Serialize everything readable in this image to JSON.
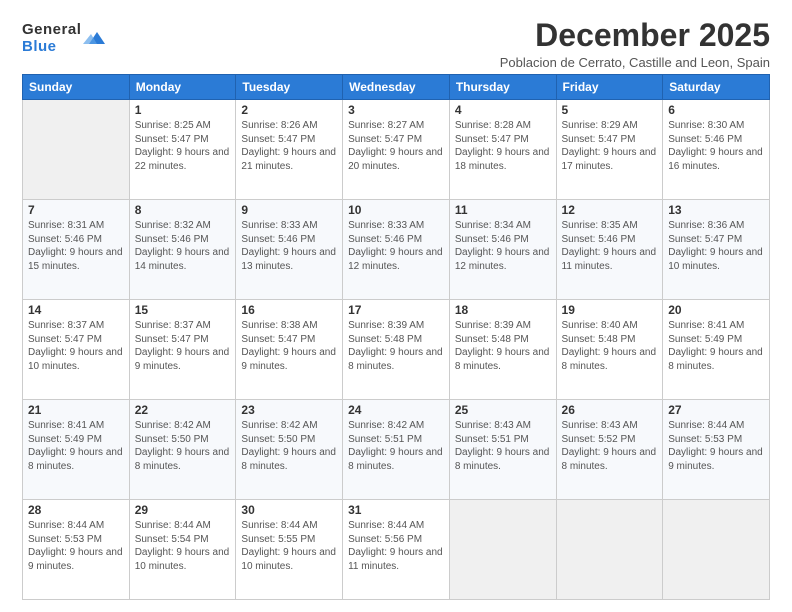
{
  "logo": {
    "general": "General",
    "blue": "Blue"
  },
  "header": {
    "month": "December 2025",
    "location": "Poblacion de Cerrato, Castille and Leon, Spain"
  },
  "weekdays": [
    "Sunday",
    "Monday",
    "Tuesday",
    "Wednesday",
    "Thursday",
    "Friday",
    "Saturday"
  ],
  "weeks": [
    [
      {
        "day": "",
        "sunrise": "",
        "sunset": "",
        "daylight": ""
      },
      {
        "day": "1",
        "sunrise": "Sunrise: 8:25 AM",
        "sunset": "Sunset: 5:47 PM",
        "daylight": "Daylight: 9 hours and 22 minutes."
      },
      {
        "day": "2",
        "sunrise": "Sunrise: 8:26 AM",
        "sunset": "Sunset: 5:47 PM",
        "daylight": "Daylight: 9 hours and 21 minutes."
      },
      {
        "day": "3",
        "sunrise": "Sunrise: 8:27 AM",
        "sunset": "Sunset: 5:47 PM",
        "daylight": "Daylight: 9 hours and 20 minutes."
      },
      {
        "day": "4",
        "sunrise": "Sunrise: 8:28 AM",
        "sunset": "Sunset: 5:47 PM",
        "daylight": "Daylight: 9 hours and 18 minutes."
      },
      {
        "day": "5",
        "sunrise": "Sunrise: 8:29 AM",
        "sunset": "Sunset: 5:47 PM",
        "daylight": "Daylight: 9 hours and 17 minutes."
      },
      {
        "day": "6",
        "sunrise": "Sunrise: 8:30 AM",
        "sunset": "Sunset: 5:46 PM",
        "daylight": "Daylight: 9 hours and 16 minutes."
      }
    ],
    [
      {
        "day": "7",
        "sunrise": "Sunrise: 8:31 AM",
        "sunset": "Sunset: 5:46 PM",
        "daylight": "Daylight: 9 hours and 15 minutes."
      },
      {
        "day": "8",
        "sunrise": "Sunrise: 8:32 AM",
        "sunset": "Sunset: 5:46 PM",
        "daylight": "Daylight: 9 hours and 14 minutes."
      },
      {
        "day": "9",
        "sunrise": "Sunrise: 8:33 AM",
        "sunset": "Sunset: 5:46 PM",
        "daylight": "Daylight: 9 hours and 13 minutes."
      },
      {
        "day": "10",
        "sunrise": "Sunrise: 8:33 AM",
        "sunset": "Sunset: 5:46 PM",
        "daylight": "Daylight: 9 hours and 12 minutes."
      },
      {
        "day": "11",
        "sunrise": "Sunrise: 8:34 AM",
        "sunset": "Sunset: 5:46 PM",
        "daylight": "Daylight: 9 hours and 12 minutes."
      },
      {
        "day": "12",
        "sunrise": "Sunrise: 8:35 AM",
        "sunset": "Sunset: 5:46 PM",
        "daylight": "Daylight: 9 hours and 11 minutes."
      },
      {
        "day": "13",
        "sunrise": "Sunrise: 8:36 AM",
        "sunset": "Sunset: 5:47 PM",
        "daylight": "Daylight: 9 hours and 10 minutes."
      }
    ],
    [
      {
        "day": "14",
        "sunrise": "Sunrise: 8:37 AM",
        "sunset": "Sunset: 5:47 PM",
        "daylight": "Daylight: 9 hours and 10 minutes."
      },
      {
        "day": "15",
        "sunrise": "Sunrise: 8:37 AM",
        "sunset": "Sunset: 5:47 PM",
        "daylight": "Daylight: 9 hours and 9 minutes."
      },
      {
        "day": "16",
        "sunrise": "Sunrise: 8:38 AM",
        "sunset": "Sunset: 5:47 PM",
        "daylight": "Daylight: 9 hours and 9 minutes."
      },
      {
        "day": "17",
        "sunrise": "Sunrise: 8:39 AM",
        "sunset": "Sunset: 5:48 PM",
        "daylight": "Daylight: 9 hours and 8 minutes."
      },
      {
        "day": "18",
        "sunrise": "Sunrise: 8:39 AM",
        "sunset": "Sunset: 5:48 PM",
        "daylight": "Daylight: 9 hours and 8 minutes."
      },
      {
        "day": "19",
        "sunrise": "Sunrise: 8:40 AM",
        "sunset": "Sunset: 5:48 PM",
        "daylight": "Daylight: 9 hours and 8 minutes."
      },
      {
        "day": "20",
        "sunrise": "Sunrise: 8:41 AM",
        "sunset": "Sunset: 5:49 PM",
        "daylight": "Daylight: 9 hours and 8 minutes."
      }
    ],
    [
      {
        "day": "21",
        "sunrise": "Sunrise: 8:41 AM",
        "sunset": "Sunset: 5:49 PM",
        "daylight": "Daylight: 9 hours and 8 minutes."
      },
      {
        "day": "22",
        "sunrise": "Sunrise: 8:42 AM",
        "sunset": "Sunset: 5:50 PM",
        "daylight": "Daylight: 9 hours and 8 minutes."
      },
      {
        "day": "23",
        "sunrise": "Sunrise: 8:42 AM",
        "sunset": "Sunset: 5:50 PM",
        "daylight": "Daylight: 9 hours and 8 minutes."
      },
      {
        "day": "24",
        "sunrise": "Sunrise: 8:42 AM",
        "sunset": "Sunset: 5:51 PM",
        "daylight": "Daylight: 9 hours and 8 minutes."
      },
      {
        "day": "25",
        "sunrise": "Sunrise: 8:43 AM",
        "sunset": "Sunset: 5:51 PM",
        "daylight": "Daylight: 9 hours and 8 minutes."
      },
      {
        "day": "26",
        "sunrise": "Sunrise: 8:43 AM",
        "sunset": "Sunset: 5:52 PM",
        "daylight": "Daylight: 9 hours and 8 minutes."
      },
      {
        "day": "27",
        "sunrise": "Sunrise: 8:44 AM",
        "sunset": "Sunset: 5:53 PM",
        "daylight": "Daylight: 9 hours and 9 minutes."
      }
    ],
    [
      {
        "day": "28",
        "sunrise": "Sunrise: 8:44 AM",
        "sunset": "Sunset: 5:53 PM",
        "daylight": "Daylight: 9 hours and 9 minutes."
      },
      {
        "day": "29",
        "sunrise": "Sunrise: 8:44 AM",
        "sunset": "Sunset: 5:54 PM",
        "daylight": "Daylight: 9 hours and 10 minutes."
      },
      {
        "day": "30",
        "sunrise": "Sunrise: 8:44 AM",
        "sunset": "Sunset: 5:55 PM",
        "daylight": "Daylight: 9 hours and 10 minutes."
      },
      {
        "day": "31",
        "sunrise": "Sunrise: 8:44 AM",
        "sunset": "Sunset: 5:56 PM",
        "daylight": "Daylight: 9 hours and 11 minutes."
      },
      {
        "day": "",
        "sunrise": "",
        "sunset": "",
        "daylight": ""
      },
      {
        "day": "",
        "sunrise": "",
        "sunset": "",
        "daylight": ""
      },
      {
        "day": "",
        "sunrise": "",
        "sunset": "",
        "daylight": ""
      }
    ]
  ]
}
